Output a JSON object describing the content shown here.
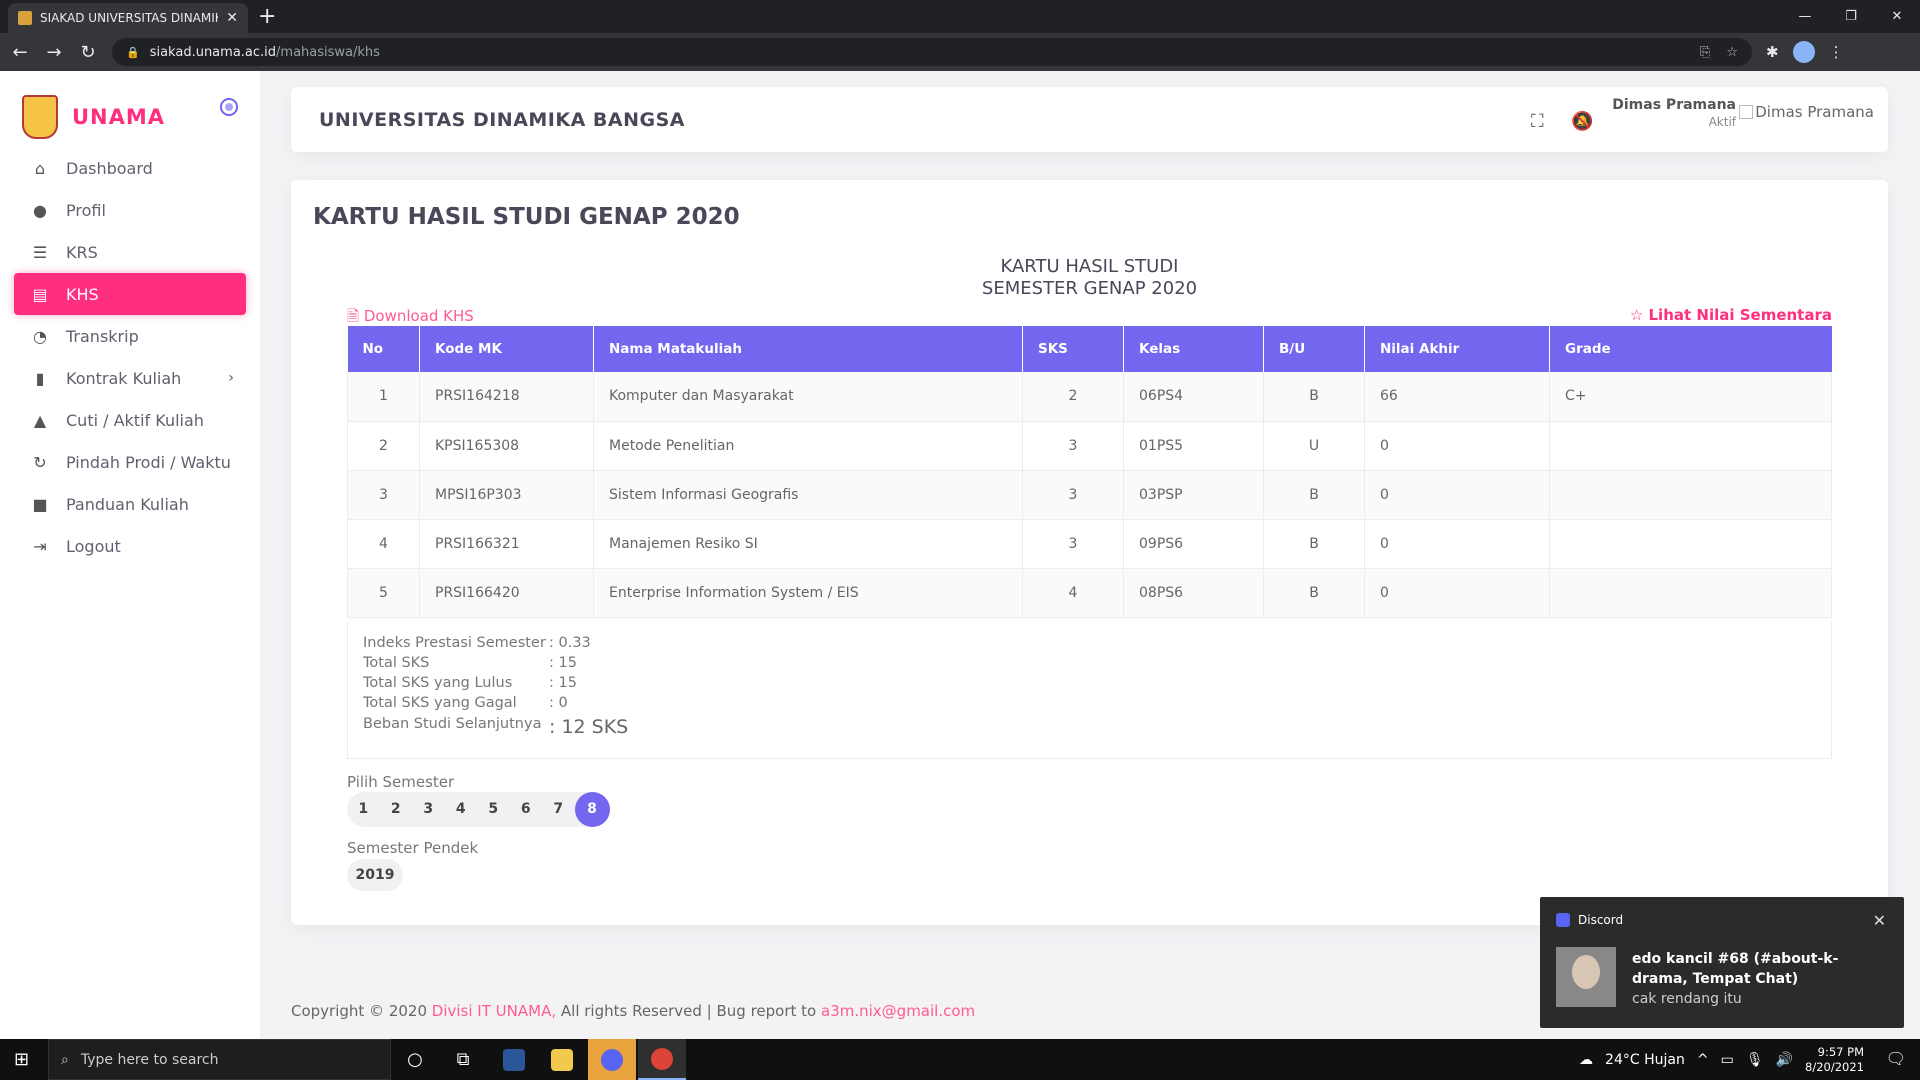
{
  "browser": {
    "tab_title": "SIAKAD UNIVERSITAS DINAMIKA",
    "tab_close": "✕",
    "new_tab": "+",
    "url_host": "siakad.unama.ac.id",
    "url_path": "/mahasiswa/khs"
  },
  "sidebar": {
    "brand": "UNAMA",
    "items": [
      {
        "label": "Dashboard",
        "icon": "⌂"
      },
      {
        "label": "Profil",
        "icon": "●"
      },
      {
        "label": "KRS",
        "icon": "☰"
      },
      {
        "label": "KHS",
        "icon": "▤"
      },
      {
        "label": "Transkrip",
        "icon": "◔"
      },
      {
        "label": "Kontrak Kuliah",
        "icon": "▮",
        "chevron": "›"
      },
      {
        "label": "Cuti / Aktif Kuliah",
        "icon": "▲"
      },
      {
        "label": "Pindah Prodi / Waktu",
        "icon": "↻"
      },
      {
        "label": "Panduan Kuliah",
        "icon": "■"
      },
      {
        "label": "Logout",
        "icon": "⇥"
      }
    ]
  },
  "header": {
    "university": "UNIVERSITAS DINAMIKA BANGSA",
    "user_name": "Dimas Pramana",
    "user_status": "Aktif",
    "avatar_alt": "Dimas Pramana"
  },
  "main": {
    "title": "KARTU HASIL STUDI GENAP 2020",
    "center_title_1": "KARTU HASIL STUDI",
    "center_title_2": "SEMESTER GENAP 2020",
    "download_label": "Download KHS",
    "lihat_label": "Lihat Nilai Sementara",
    "columns": [
      "No",
      "Kode MK",
      "Nama Matakuliah",
      "SKS",
      "Kelas",
      "B/U",
      "Nilai Akhir",
      "Grade"
    ],
    "rows": [
      [
        "1",
        "PRSI164218",
        "Komputer dan Masyarakat",
        "2",
        "06PS4",
        "B",
        "66",
        "C+"
      ],
      [
        "2",
        "KPSI165308",
        "Metode Penelitian",
        "3",
        "01PS5",
        "U",
        "0",
        ""
      ],
      [
        "3",
        "MPSI16P303",
        "Sistem Informasi Geografis",
        "3",
        "03PSP",
        "B",
        "0",
        ""
      ],
      [
        "4",
        "PRSI166321",
        "Manajemen Resiko SI",
        "3",
        "09PS6",
        "B",
        "0",
        ""
      ],
      [
        "5",
        "PRSI166420",
        "Enterprise Information System / EIS",
        "4",
        "08PS6",
        "B",
        "0",
        ""
      ]
    ],
    "summary": [
      {
        "label": "Indeks Prestasi Semester",
        "value": ": 0.33"
      },
      {
        "label": "Total SKS",
        "value": ": 15"
      },
      {
        "label": "Total SKS yang Lulus",
        "value": ": 15"
      },
      {
        "label": "Total SKS yang Gagal",
        "value": ": 0"
      },
      {
        "label": "Beban Studi Selanjutnya",
        "value": ": 12 SKS"
      }
    ],
    "pilih_semester_label": "Pilih Semester",
    "semesters": [
      "1",
      "2",
      "3",
      "4",
      "5",
      "6",
      "7",
      "8"
    ],
    "active_semester": "8",
    "semester_pendek_label": "Semester Pendek",
    "semester_pendek": "2019"
  },
  "footer": {
    "prefix": "Copyright © 2020",
    "division": "Divisi IT UNAMA,",
    "middle": "All rights Reserved | Bug report to",
    "email": "a3m.nix@gmail.com"
  },
  "toast": {
    "app": "Discord",
    "title": "edo kancil #68 (#about-k-drama, Tempat Chat)",
    "message": "cak rendang itu"
  },
  "taskbar": {
    "search_placeholder": "Type here to search",
    "weather": "24°C  Hujan",
    "time": "9:57 PM",
    "date": "8/20/2021"
  },
  "colors": {
    "accent_pink": "#ff2e7e",
    "accent_purple": "#7367f0"
  }
}
